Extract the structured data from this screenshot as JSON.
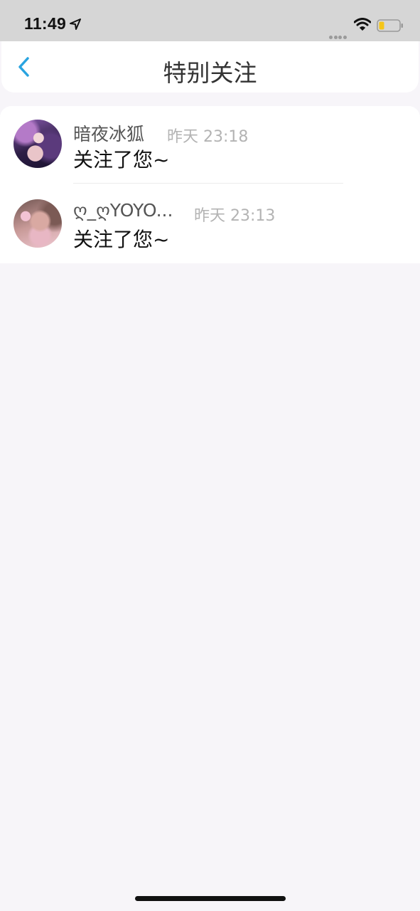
{
  "status_bar": {
    "time": "11:49"
  },
  "nav": {
    "title": "特别关注",
    "accent_color": "#2aa4e0"
  },
  "items": [
    {
      "name": "暗夜冰狐",
      "time": "昨天 23:18",
      "message": "关注了您~"
    },
    {
      "name": "ღ_ღYOYO...",
      "time": "昨天 23:13",
      "message": "关注了您~"
    }
  ]
}
